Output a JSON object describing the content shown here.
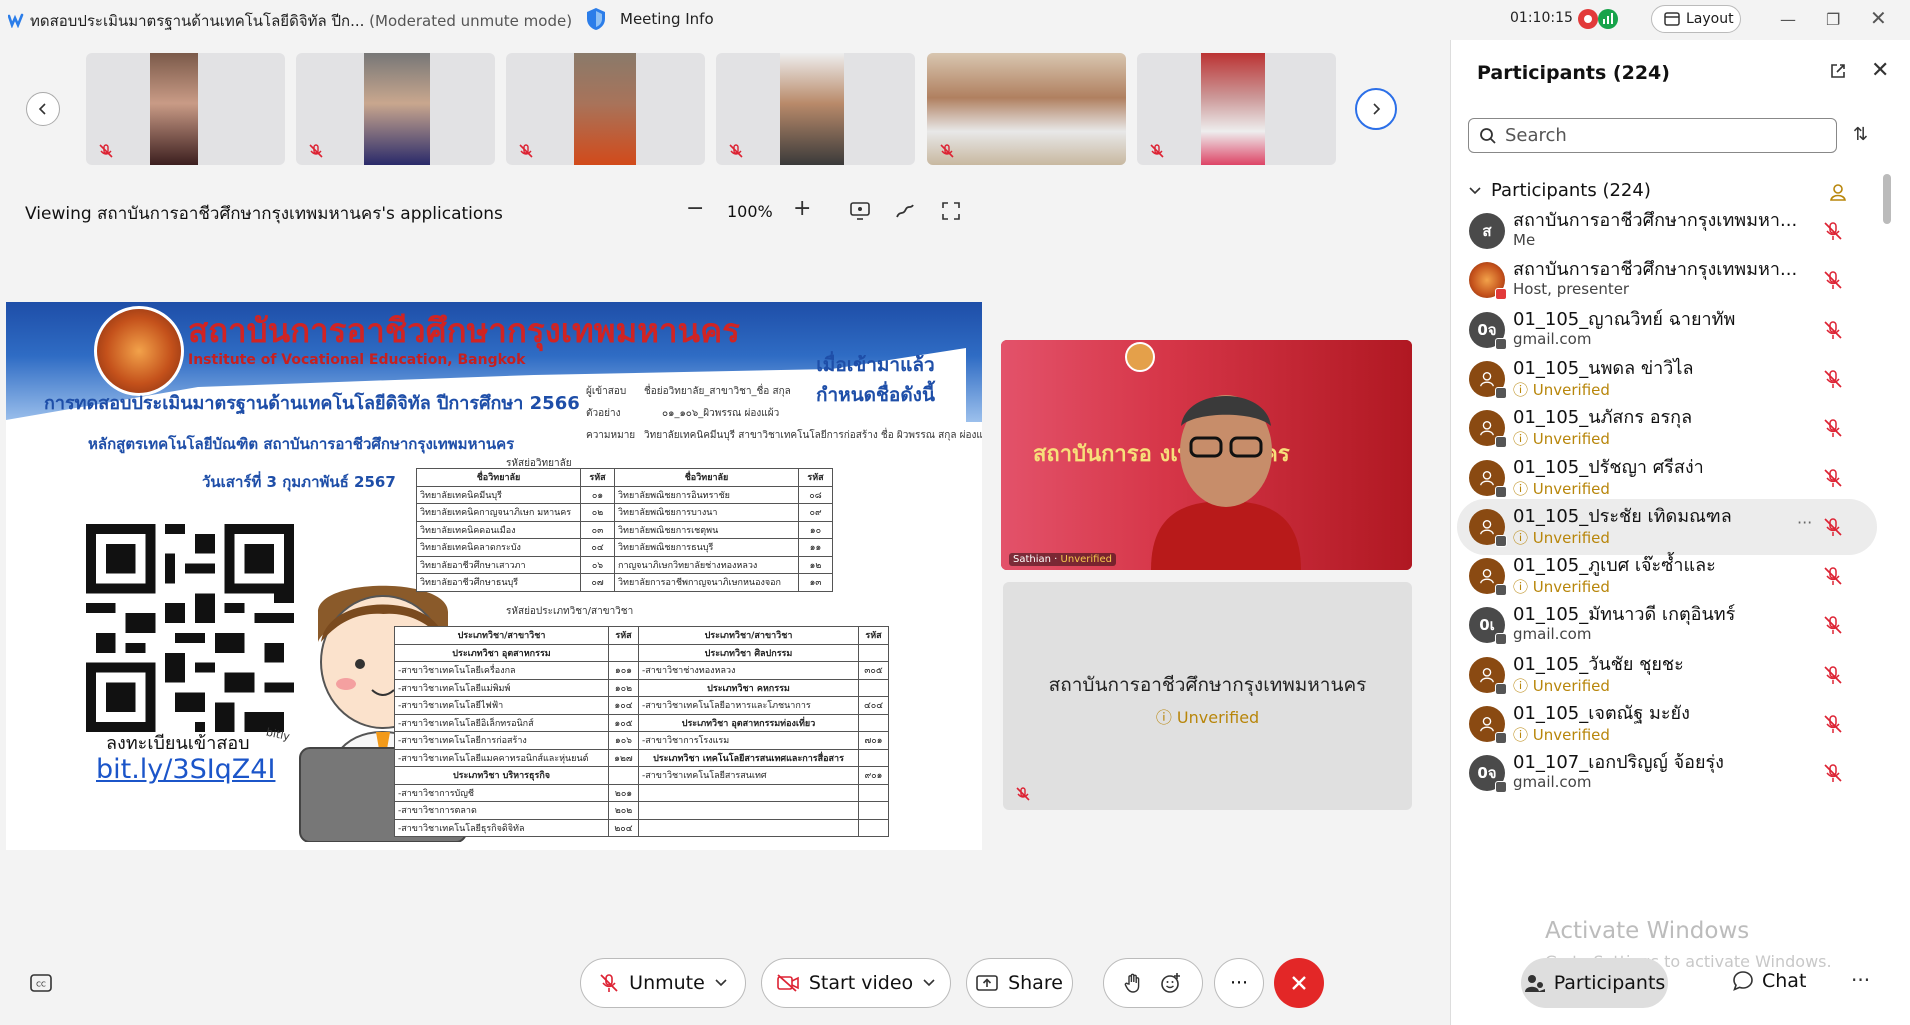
{
  "titlebar": {
    "title": "ทดสอบประเมินมาตรฐานด้านเทคโนโลยีดิจิทัล ปีก...",
    "mode": "(Moderated unmute mode)",
    "meeting_info": "Meeting Info",
    "timer": "01:10:15",
    "layout_label": "Layout",
    "colors": {
      "rec": "#e23a3a",
      "stats": "#17a34a",
      "accent": "#2b6fe8"
    }
  },
  "toolbar": {
    "viewing_text": "Viewing สถาบันการอาชีวศึกษากรุงเทพมหานคร's applications",
    "zoom_minus": "−",
    "zoom_level": "100%",
    "zoom_plus": "+"
  },
  "slide": {
    "institute_th": "สถาบันการอาชีวศึกษากรุงเทพมหานคร",
    "institute_en": "Institute of Vocational Education, Bangkok",
    "when_line1": "เมื่อเข้ามาแล้ว",
    "when_line2": "กำหนดชื่อดังนี้",
    "exam_title": "การทดสอบประเมินมาตรฐานด้านเทคโนโลยีดิจิทัล ปีการศึกษา 2566",
    "course": "หลักสูตรเทคโนโลยีบัณฑิต สถาบันการอาชีวศึกษากรุงเทพมหานคร",
    "date": "วันเสาร์ที่ 3 กุมภาพันธ์ 2567",
    "naming_format_label": "ผู้เข้าสอบ",
    "naming_format": "ชื่อย่อวิทยาลัย_สาขาวิชา_ชื่อ สกุล",
    "example_label": "ตัวอย่าง",
    "example": "๐๑_๑๐๖_ผิวพรรณ ผ่องแผ้ว",
    "meaning_label": "ความหมาย",
    "meaning": "วิทยาลัยเทคนิคมีนบุรี สาขาวิชาเทคโนโลยีการก่อสร้าง ชื่อ ผิวพรรณ สกุล ผ่องแผ้ว",
    "college_code_label": "รหัสย่อวิทยาลัย",
    "major_code_label": "รหัสย่อประเภทวิชา/สาขาวิชา",
    "register_label": "ลงทะเบียนเข้าสอบ",
    "register_link": "bit.ly/3SIqZ4I",
    "qr_brand": "bitly",
    "college_table": {
      "headers": [
        "ชื่อวิทยาลัย",
        "รหัส",
        "ชื่อวิทยาลัย",
        "รหัส"
      ],
      "rows": [
        [
          "วิทยาลัยเทคนิคมีนบุรี",
          "๐๑",
          "วิทยาลัยพณิชยการอินทราชัย",
          "๐๘"
        ],
        [
          "วิทยาลัยเทคนิคกาญจนาภิเษก มหานคร",
          "๐๒",
          "วิทยาลัยพณิชยการบางนา",
          "๐๙"
        ],
        [
          "วิทยาลัยเทคนิคดอนเมือง",
          "๐๓",
          "วิทยาลัยพณิชยการเชตุพน",
          "๑๐"
        ],
        [
          "วิทยาลัยเทคนิคลาดกระบัง",
          "๐๔",
          "วิทยาลัยพณิชยการธนบุรี",
          "๑๑"
        ],
        [
          "วิทยาลัยอาชีวศึกษาเสาวภา",
          "๐๖",
          "กาญจนาภิเษกวิทยาลัยช่างทองหลวง",
          "๑๒"
        ],
        [
          "วิทยาลัยอาชีวศึกษาธนบุรี",
          "๐๗",
          "วิทยาลัยการอาชีพกาญจนาภิเษกหนองจอก",
          "๑๓"
        ]
      ]
    },
    "major_table": {
      "headers": [
        "ประเภทวิชา/สาขาวิชา",
        "รหัส",
        "ประเภทวิชา/สาขาวิชา",
        "รหัส"
      ],
      "rows": [
        [
          "ประเภทวิชา อุตสาหกรรม",
          "",
          "ประเภทวิชา ศิลปกรรม",
          ""
        ],
        [
          "-สาขาวิชาเทคโนโลยีเครื่องกล",
          "๑๐๑",
          "-สาขาวิชาช่างทองหลวง",
          "๓๐๕"
        ],
        [
          "-สาขาวิชาเทคโนโลยีแม่พิมพ์",
          "๑๐๒",
          "ประเภทวิชา คหกรรม",
          ""
        ],
        [
          "-สาขาวิชาเทคโนโลยีไฟฟ้า",
          "๑๐๔",
          "-สาขาวิชาเทคโนโลยีอาหารและโภชนาการ",
          "๔๐๔"
        ],
        [
          "-สาขาวิชาเทคโนโลยีอิเล็กทรอนิกส์",
          "๑๐๕",
          "ประเภทวิชา อุตสาหกรรมท่องเที่ยว",
          ""
        ],
        [
          "-สาขาวิชาเทคโนโลยีการก่อสร้าง",
          "๑๐๖",
          "-สาขาวิชาการโรงแรม",
          "๗๐๑"
        ],
        [
          "-สาขาวิชาเทคโนโลยีแมคคาทรอนิกส์และหุ่นยนต์",
          "๑๒๗",
          "ประเภทวิชา เทคโนโลยีสารสนเทศและการสื่อสาร",
          ""
        ],
        [
          "ประเภทวิชา บริหารธุรกิจ",
          "",
          "-สาขาวิชาเทคโนโลยีสารสนเทศ",
          "๙๐๑"
        ],
        [
          "-สาขาวิชาการบัญชี",
          "๒๐๑",
          "",
          ""
        ],
        [
          "-สาขาวิชาการตลาด",
          "๒๐๒",
          "",
          ""
        ],
        [
          "-สาขาวิชาเทคโนโลยีธุรกิจดิจิทัล",
          "๒๐๔",
          "",
          ""
        ]
      ]
    }
  },
  "presenter": {
    "backdrop_text": "สถาบันการอ          งเทพมหานคร",
    "name": "Sathian",
    "status": "Unverified"
  },
  "tile": {
    "name": "สถาบันการอาชีวศึกษากรุงเทพมหานคร",
    "status": "Unverified"
  },
  "panel": {
    "title": "Participants (224)",
    "search_placeholder": "Search",
    "section_label": "Participants (224)",
    "participants": [
      {
        "initial": "ส",
        "name": "สถาบันการอาชีวศึกษากรุงเทพมหา...",
        "sub": "Me",
        "kind": "plain"
      },
      {
        "initial": "",
        "name": "สถาบันการอาชีวศึกษากรุงเทพมหา...",
        "sub": "Host, presenter",
        "kind": "plain"
      },
      {
        "initial": "0จ",
        "name": "01_105_ญาณวิทย์ ฉายาทัพ",
        "sub": "gmail.com",
        "kind": "plain"
      },
      {
        "initial": "",
        "name": "01_105_นพดล ข่าวิไล",
        "sub": "Unverified",
        "kind": "unv"
      },
      {
        "initial": "",
        "name": "01_105_นภัสกร อรกุล",
        "sub": "Unverified",
        "kind": "unv"
      },
      {
        "initial": "",
        "name": "01_105_ปรัชญา ศรีสง่า",
        "sub": "Unverified",
        "kind": "unv"
      },
      {
        "initial": "",
        "name": "01_105_ประชัย เทิดมณฑล",
        "sub": "Unverified",
        "kind": "unv"
      },
      {
        "initial": "",
        "name": "01_105_ภูเบศ เจ๊ะซ้ำและ",
        "sub": "Unverified",
        "kind": "unv"
      },
      {
        "initial": "0เ",
        "name": "01_105_มัทนาวดี เกตุอินทร์",
        "sub": "gmail.com",
        "kind": "plain"
      },
      {
        "initial": "",
        "name": "01_105_วันชัย ชุยชะ",
        "sub": "Unverified",
        "kind": "unv"
      },
      {
        "initial": "",
        "name": "01_105_เจตณัฐ มะยัง",
        "sub": "Unverified",
        "kind": "unv"
      },
      {
        "initial": "0จ",
        "name": "01_107_เอกปริญญ์ จ้อยรุ่ง",
        "sub": "gmail.com",
        "kind": "plain"
      }
    ]
  },
  "controls": {
    "unmute": "Unmute",
    "start_video": "Start video",
    "share": "Share",
    "more": "···",
    "participants": "Participants",
    "chat": "Chat",
    "more_right": "···",
    "end_color": "#e32727"
  },
  "watermark": {
    "line1": "Activate Windows",
    "line2": "Go to Settings to activate Windows."
  }
}
